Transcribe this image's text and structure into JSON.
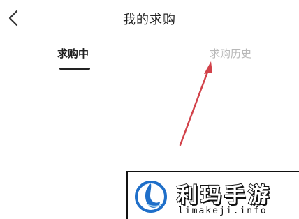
{
  "header": {
    "title": "我的求购",
    "back_icon": "chevron-left-icon"
  },
  "tabs": [
    {
      "label": "求购中",
      "active": true
    },
    {
      "label": "求购历史",
      "active": false
    }
  ],
  "annotation": {
    "arrow_color": "#d2424a"
  },
  "watermark": {
    "name": "利玛手游",
    "url": "limakeji.info"
  },
  "colors": {
    "title": "#222222",
    "tab_active": "#222222",
    "tab_inactive": "#b8b8b8",
    "logo_blue": "#1f6fc9"
  }
}
